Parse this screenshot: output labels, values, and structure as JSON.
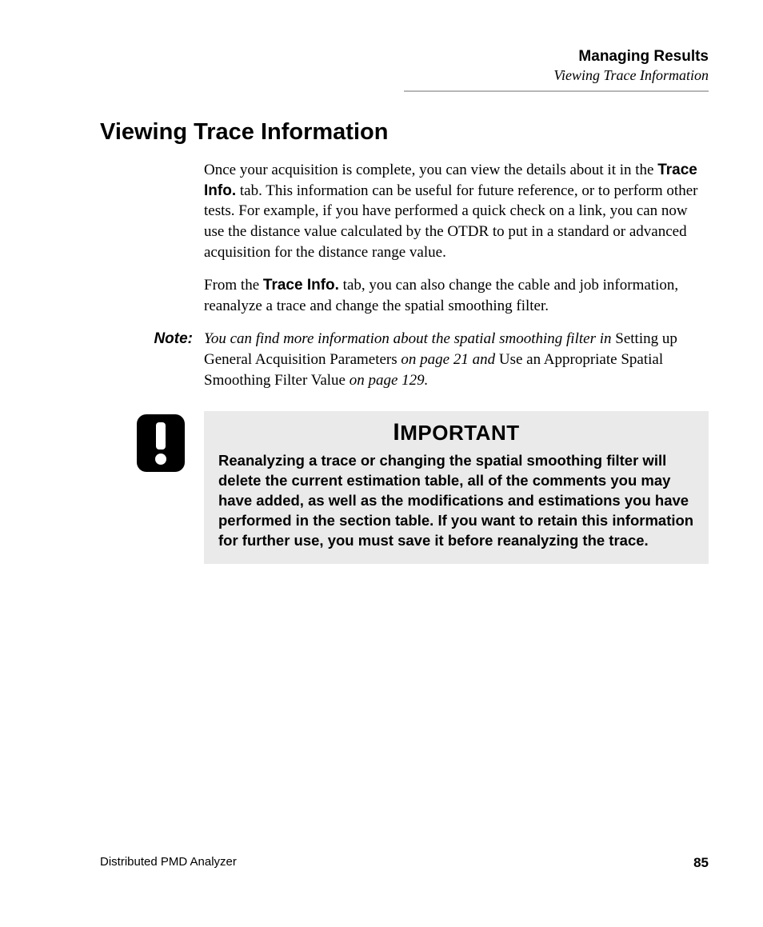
{
  "header": {
    "chapter": "Managing Results",
    "section": "Viewing Trace Information"
  },
  "title": "Viewing Trace Information",
  "para1": {
    "t1": "Once your acquisition is complete, you can view the details about it in the ",
    "b1": "Trace Info.",
    "t2": " tab. This information can be useful for future reference, or to perform other tests. For example, if you have performed a quick check on a link, you can now use the distance value calculated by the OTDR to put in a standard or advanced acquisition for the distance range value."
  },
  "para2": {
    "t1": "From the ",
    "b1": "Trace Info.",
    "t2": " tab, you can also change the cable and job information, reanalyze a trace and change the spatial smoothing filter."
  },
  "note": {
    "label": "Note:",
    "i1": "You can find more information about the spatial smoothing filter in ",
    "r1": "Setting up General Acquisition Parameters",
    "i2": " on page 21 and ",
    "r2": "Use an Appropriate Spatial Smoothing Filter Value",
    "i3": " on page 129."
  },
  "callout": {
    "title_first": "I",
    "title_rest": "MPORTANT",
    "body": "Reanalyzing a trace or changing the spatial smoothing filter will delete the current estimation table, all of the comments you may have added, as well as the modifications and estimations you have performed in the section table. If you want to retain this information for further use, you must save it before reanalyzing the trace."
  },
  "footer": {
    "product": "Distributed PMD Analyzer",
    "page": "85"
  }
}
